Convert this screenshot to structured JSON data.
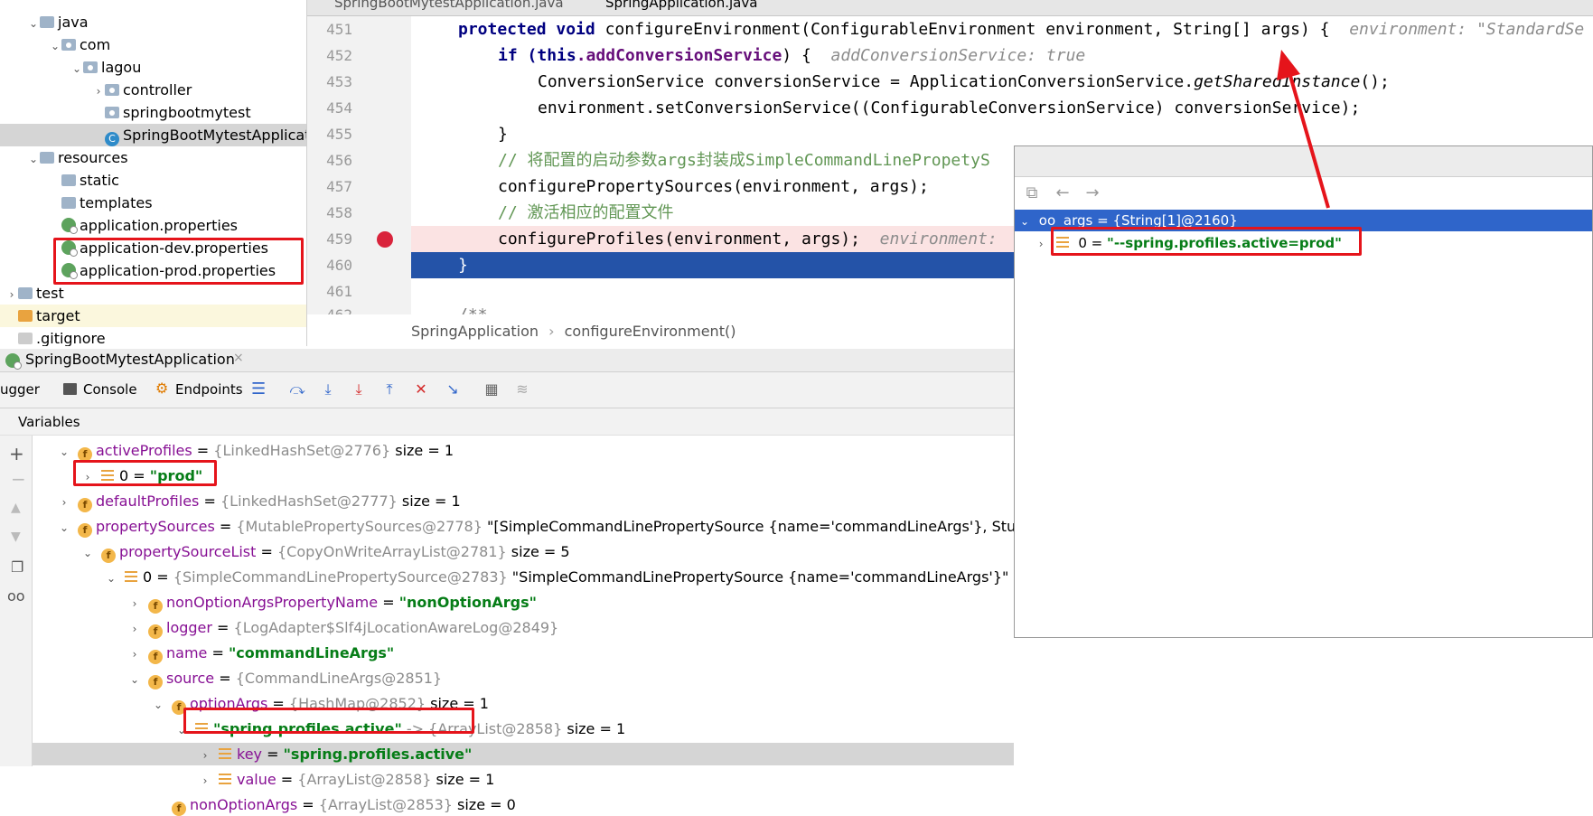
{
  "editor_tabs": [
    "SpringBootMytestApplication.java",
    "SpringApplication.java"
  ],
  "project_tree": [
    {
      "label": "java",
      "indent": 1,
      "arrow": "⌄",
      "icon": "folder"
    },
    {
      "label": "com",
      "indent": 2,
      "arrow": "⌄",
      "icon": "package"
    },
    {
      "label": "lagou",
      "indent": 3,
      "arrow": "⌄",
      "icon": "package"
    },
    {
      "label": "controller",
      "indent": 4,
      "arrow": "›",
      "icon": "package"
    },
    {
      "label": "springbootmytest",
      "indent": 4,
      "arrow": "",
      "icon": "package"
    },
    {
      "label": "SpringBootMytestApplicat",
      "indent": 4,
      "arrow": "",
      "icon": "class"
    },
    {
      "label": "resources",
      "indent": 1,
      "arrow": "⌄",
      "icon": "folder"
    },
    {
      "label": "static",
      "indent": 2,
      "arrow": "",
      "icon": "folder"
    },
    {
      "label": "templates",
      "indent": 2,
      "arrow": "",
      "icon": "folder"
    },
    {
      "label": "application.properties",
      "indent": 2,
      "arrow": "",
      "icon": "leaf"
    },
    {
      "label": "application-dev.properties",
      "indent": 2,
      "arrow": "",
      "icon": "leaf"
    },
    {
      "label": "application-prod.properties",
      "indent": 2,
      "arrow": "",
      "icon": "leaf"
    },
    {
      "label": "test",
      "indent": 0,
      "arrow": "›",
      "icon": "folder"
    },
    {
      "label": "target",
      "indent": 0,
      "arrow": "",
      "icon": "folder-orange"
    },
    {
      "label": ".gitignore",
      "indent": 0,
      "arrow": "",
      "icon": "file"
    }
  ],
  "code": {
    "lines": [
      "451",
      "452",
      "453",
      "454",
      "455",
      "456",
      "457",
      "458",
      "459",
      "460",
      "461",
      "462"
    ],
    "l451_a": "protected void ",
    "l451_b": "configureEnvironment(ConfigurableEnvironment environment, String[] args) {",
    "l451_hint": "environment: \"StandardSe",
    "l452_a": "if (",
    "l452_b": "this",
    "l452_c": ".addConversionService",
    "l452_d": ") {",
    "l452_hint": "addConversionService: true",
    "l453_a": "ConversionService conversionService = ApplicationConversionService.",
    "l453_b": "getSharedInstance",
    "l453_c": "();",
    "l454": "environment.setConversionService((ConfigurableConversionService) conversionService);",
    "l455": "}",
    "l456": "// 将配置的启动参数args封装成SimpleCommandLinePropetyS",
    "l457": "configurePropertySources(environment, args);",
    "l458": "// 激活相应的配置文件",
    "l459": "configureProfiles(environment, args);",
    "l459_hint": "environment:",
    "l460": "}",
    "l462": "/**"
  },
  "breadcrumb": {
    "a": "SpringApplication",
    "sep": "›",
    "b": "configureEnvironment()"
  },
  "popup": {
    "back": "←",
    "forward": "→",
    "row1": "args = {String[1]@2160}",
    "row2_name": "0 = ",
    "row2_value": "\"--spring.profiles.active=prod\""
  },
  "debug_tab_title": "SpringBootMytestApplication",
  "debug_tabs": {
    "debugger": "ugger",
    "console": "Console",
    "endpoints": "Endpoints"
  },
  "variables_label": "Variables",
  "variables": [
    {
      "indent": 0,
      "arrow": "⌄",
      "icon": "f",
      "name": "activeProfiles",
      "eq": " = ",
      "type": "{LinkedHashSet@2776}",
      "extra": "  size = 1",
      "str": ""
    },
    {
      "indent": 1,
      "arrow": "›",
      "icon": "list",
      "name": "0",
      "eq": " = ",
      "type": "",
      "extra": "",
      "str": "\"prod\"",
      "plain": true
    },
    {
      "indent": 0,
      "arrow": "›",
      "icon": "f",
      "name": "defaultProfiles",
      "eq": " = ",
      "type": "{LinkedHashSet@2777}",
      "extra": "  size = 1",
      "str": ""
    },
    {
      "indent": 0,
      "arrow": "⌄",
      "icon": "f",
      "name": "propertySources",
      "eq": " = ",
      "type": "{MutablePropertySources@2778}",
      "extra": " \"[SimpleCommandLinePropertySource {name='commandLineArgs'}, StubProper",
      "str": ""
    },
    {
      "indent": 1,
      "arrow": "⌄",
      "icon": "f",
      "name": "propertySourceList",
      "eq": " = ",
      "type": "{CopyOnWriteArrayList@2781}",
      "extra": "  size = 5",
      "str": ""
    },
    {
      "indent": 2,
      "arrow": "⌄",
      "icon": "list",
      "name": "0",
      "eq": " = ",
      "type": "{SimpleCommandLinePropertySource@2783}",
      "extra": " \"SimpleCommandLinePropertySource {name='commandLineArgs'}\"",
      "str": "",
      "plain": true
    },
    {
      "indent": 3,
      "arrow": "›",
      "icon": "f",
      "name": "nonOptionArgsPropertyName",
      "eq": " = ",
      "type": "",
      "extra": "",
      "str": "\"nonOptionArgs\""
    },
    {
      "indent": 3,
      "arrow": "›",
      "icon": "f",
      "name": "logger",
      "eq": " = ",
      "type": "{LogAdapter$Slf4jLocationAwareLog@2849}",
      "extra": "",
      "str": ""
    },
    {
      "indent": 3,
      "arrow": "›",
      "icon": "f",
      "name": "name",
      "eq": " = ",
      "type": "",
      "extra": "",
      "str": "\"commandLineArgs\""
    },
    {
      "indent": 3,
      "arrow": "⌄",
      "icon": "f",
      "name": "source",
      "eq": " = ",
      "type": "{CommandLineArgs@2851}",
      "extra": "",
      "str": ""
    },
    {
      "indent": 4,
      "arrow": "⌄",
      "icon": "f",
      "name": "optionArgs",
      "eq": " = ",
      "type": "{HashMap@2852}",
      "extra": "  size = 1",
      "str": ""
    },
    {
      "indent": 5,
      "arrow": "⌄",
      "icon": "list",
      "name": "",
      "eq": "",
      "type": " -> {ArrayList@2858}",
      "extra": "  size = 1",
      "str": "\"spring.profiles.active\"",
      "strFirst": true
    },
    {
      "indent": 6,
      "arrow": "›",
      "icon": "list",
      "name": "key",
      "eq": " = ",
      "type": "",
      "extra": "",
      "str": "\"spring.profiles.active\"",
      "sel": true
    },
    {
      "indent": 6,
      "arrow": "›",
      "icon": "list",
      "name": "value",
      "eq": " = ",
      "type": "{ArrayList@2858}",
      "extra": "  size = 1",
      "str": ""
    },
    {
      "indent": 4,
      "arrow": "",
      "icon": "f",
      "name": "nonOptionArgs",
      "eq": " = ",
      "type": "{ArrayList@2853}",
      "extra": "  size = 0",
      "str": ""
    }
  ]
}
